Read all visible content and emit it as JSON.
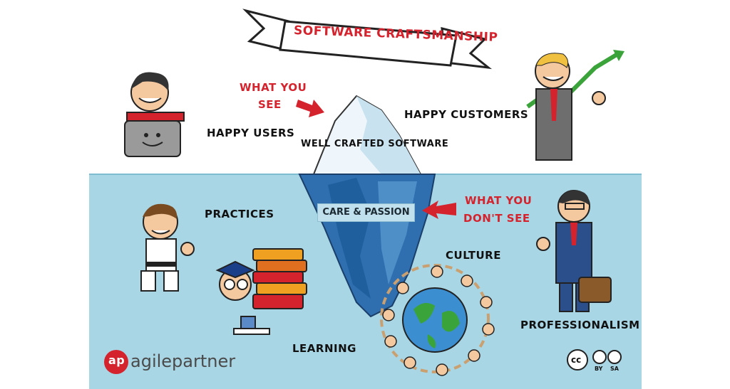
{
  "title": "SOFTWARE CRAFTSMANSHIP",
  "above": {
    "what_you_see": [
      "WHAT YOU",
      "SEE"
    ],
    "happy_users": "HAPPY USERS",
    "happy_customers": "HAPPY CUSTOMERS",
    "well_crafted": "WELL CRAFTED SOFTWARE"
  },
  "below": {
    "what_you_dont_see": [
      "WHAT YOU",
      "DON'T SEE"
    ],
    "care_passion": "CARE & PASSION",
    "practices": "PRACTICES",
    "culture": "CULTURE",
    "learning": "LEARNING",
    "professionalism": "PROFESSIONALISM"
  },
  "footer": {
    "logo_mark": "ap",
    "logo_text": "agilepartner",
    "license_cc": "cc",
    "license_by": "BY",
    "license_sa": "SA"
  },
  "colors": {
    "water": "#a9d6e5",
    "accent_red": "#d5232e",
    "iceberg_dark": "#1f5f9e"
  }
}
